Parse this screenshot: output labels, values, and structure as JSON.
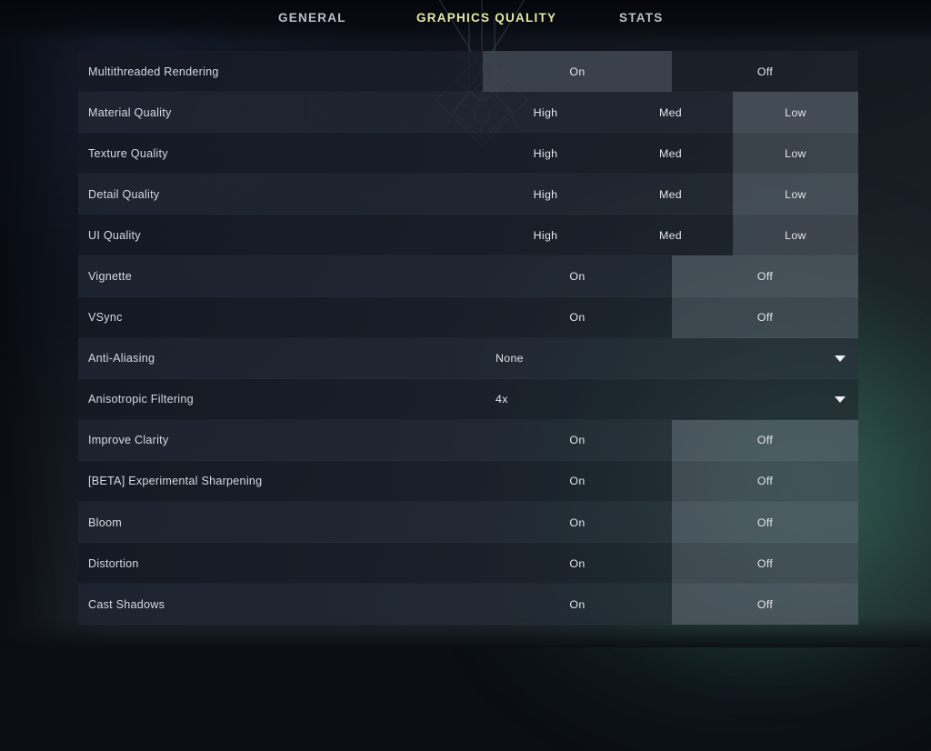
{
  "tabs": [
    {
      "label": "GENERAL",
      "active": false
    },
    {
      "label": "GRAPHICS QUALITY",
      "active": true
    },
    {
      "label": "STATS",
      "active": false
    }
  ],
  "accent_color": "#e6e8a8",
  "settings": [
    {
      "label": "Multithreaded Rendering",
      "type": "toggle",
      "options": [
        "On",
        "Off"
      ],
      "selected": 0
    },
    {
      "label": "Material Quality",
      "type": "triple",
      "options": [
        "High",
        "Med",
        "Low"
      ],
      "selected": 2
    },
    {
      "label": "Texture Quality",
      "type": "triple",
      "options": [
        "High",
        "Med",
        "Low"
      ],
      "selected": 2
    },
    {
      "label": "Detail Quality",
      "type": "triple",
      "options": [
        "High",
        "Med",
        "Low"
      ],
      "selected": 2
    },
    {
      "label": "UI Quality",
      "type": "triple",
      "options": [
        "High",
        "Med",
        "Low"
      ],
      "selected": 2
    },
    {
      "label": "Vignette",
      "type": "toggle",
      "options": [
        "On",
        "Off"
      ],
      "selected": 1
    },
    {
      "label": "VSync",
      "type": "toggle",
      "options": [
        "On",
        "Off"
      ],
      "selected": 1
    },
    {
      "label": "Anti-Aliasing",
      "type": "dropdown",
      "value": "None"
    },
    {
      "label": "Anisotropic Filtering",
      "type": "dropdown",
      "value": "4x"
    },
    {
      "label": "Improve Clarity",
      "type": "toggle",
      "options": [
        "On",
        "Off"
      ],
      "selected": 1
    },
    {
      "label": "[BETA] Experimental Sharpening",
      "type": "toggle",
      "options": [
        "On",
        "Off"
      ],
      "selected": 1
    },
    {
      "label": "Bloom",
      "type": "toggle",
      "options": [
        "On",
        "Off"
      ],
      "selected": 1
    },
    {
      "label": "Distortion",
      "type": "toggle",
      "options": [
        "On",
        "Off"
      ],
      "selected": 1
    },
    {
      "label": "Cast Shadows",
      "type": "toggle",
      "options": [
        "On",
        "Off"
      ],
      "selected": 1
    }
  ]
}
